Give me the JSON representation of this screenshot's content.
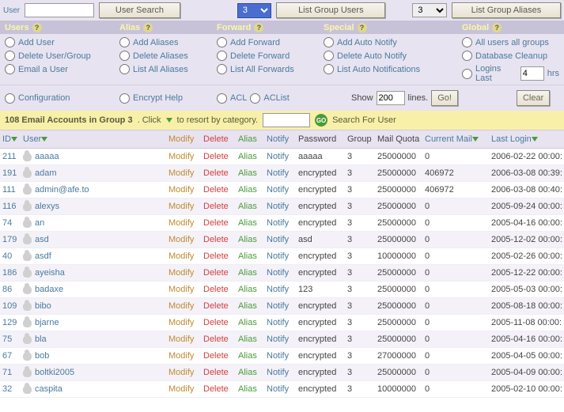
{
  "top": {
    "user_label": "User",
    "user_value": "",
    "user_search_btn": "User Search",
    "group_select": "3",
    "list_group_users_btn": "List Group Users",
    "alias_select": "3",
    "list_group_aliases_btn": "List Group Aliases"
  },
  "cats": {
    "users": "Users",
    "alias": "Alias",
    "forward": "Forward",
    "special": "Special",
    "global": "Global"
  },
  "actions": {
    "users": [
      "Add User",
      "Delete User/Group",
      "Email a User"
    ],
    "alias": [
      "Add Aliases",
      "Delete Aliases",
      "List All Aliases"
    ],
    "forward": [
      "Add Forward",
      "Delete Forward",
      "List All Forwards"
    ],
    "special": [
      "Add Auto Notify",
      "Delete Auto Notify",
      "List Auto Notifications"
    ],
    "global": [
      "All users all groups",
      "Database Cleanup"
    ],
    "logins_last": "Logins Last",
    "logins_hrs_value": "4",
    "hrs": "hrs"
  },
  "row2": {
    "configuration": "Configuration",
    "encrypt_help": "Encrypt Help",
    "acl": "ACL",
    "aclist": "ACList",
    "show": "Show",
    "lines_value": "200",
    "lines": "lines.",
    "go": "Go!",
    "clear": "Clear"
  },
  "searchbar": {
    "count": "108 Email Accounts in Group 3",
    "hint": ". Click",
    "hint2": "to resort by category.",
    "input_value": "",
    "search_for_user": "Search For User"
  },
  "headers": {
    "id": "ID",
    "user": "User",
    "modify": "Modify",
    "delete": "Delete",
    "alias": "Alias",
    "notify": "Notify",
    "password": "Password",
    "group": "Group",
    "mail_quota": "Mail Quota",
    "current_mail": "Current Mail",
    "last_login": "Last Login"
  },
  "link_labels": {
    "modify": "Modify",
    "delete": "Delete",
    "alias": "Alias",
    "notify": "Notify"
  },
  "rows": [
    {
      "id": "211",
      "user": "aaaaa",
      "pw": "aaaaa",
      "grp": "3",
      "quota": "25000000",
      "mail": "0",
      "login": "2006-02-22 00:00:"
    },
    {
      "id": "191",
      "user": "adam",
      "pw": "encrypted",
      "grp": "3",
      "quota": "25000000",
      "mail": "406972",
      "login": "2006-03-08 00:39:"
    },
    {
      "id": "111",
      "user": "admin@afe.to",
      "pw": "encrypted",
      "grp": "3",
      "quota": "25000000",
      "mail": "406972",
      "login": "2006-03-08 00:40:"
    },
    {
      "id": "116",
      "user": "alexys",
      "pw": "encrypted",
      "grp": "3",
      "quota": "25000000",
      "mail": "0",
      "login": "2005-09-24 00:00:"
    },
    {
      "id": "74",
      "user": "an",
      "pw": "encrypted",
      "grp": "3",
      "quota": "25000000",
      "mail": "0",
      "login": "2005-04-16 00:00:"
    },
    {
      "id": "179",
      "user": "asd",
      "pw": "asd",
      "grp": "3",
      "quota": "25000000",
      "mail": "0",
      "login": "2005-12-02 00:00:"
    },
    {
      "id": "40",
      "user": "asdf",
      "pw": "encrypted",
      "grp": "3",
      "quota": "10000000",
      "mail": "0",
      "login": "2005-02-26 00:00:"
    },
    {
      "id": "186",
      "user": "ayeisha",
      "pw": "encrypted",
      "grp": "3",
      "quota": "25000000",
      "mail": "0",
      "login": "2005-12-22 00:00:"
    },
    {
      "id": "86",
      "user": "badaxe",
      "pw": "123",
      "grp": "3",
      "quota": "25000000",
      "mail": "0",
      "login": "2005-05-03 00:00:"
    },
    {
      "id": "109",
      "user": "bibo",
      "pw": "encrypted",
      "grp": "3",
      "quota": "25000000",
      "mail": "0",
      "login": "2005-08-18 00:00:"
    },
    {
      "id": "129",
      "user": "bjarne",
      "pw": "encrypted",
      "grp": "3",
      "quota": "25000000",
      "mail": "0",
      "login": "2005-11-08 00:00:"
    },
    {
      "id": "75",
      "user": "bla",
      "pw": "encrypted",
      "grp": "3",
      "quota": "25000000",
      "mail": "0",
      "login": "2005-04-16 00:00:"
    },
    {
      "id": "67",
      "user": "bob",
      "pw": "encrypted",
      "grp": "3",
      "quota": "27000000",
      "mail": "0",
      "login": "2005-04-05 00:00:"
    },
    {
      "id": "71",
      "user": "boltki2005",
      "pw": "encrypted",
      "grp": "3",
      "quota": "25000000",
      "mail": "0",
      "login": "2005-04-09 00:00:"
    },
    {
      "id": "32",
      "user": "caspita",
      "pw": "encrypted",
      "grp": "3",
      "quota": "10000000",
      "mail": "0",
      "login": "2005-02-10 00:00:"
    }
  ]
}
